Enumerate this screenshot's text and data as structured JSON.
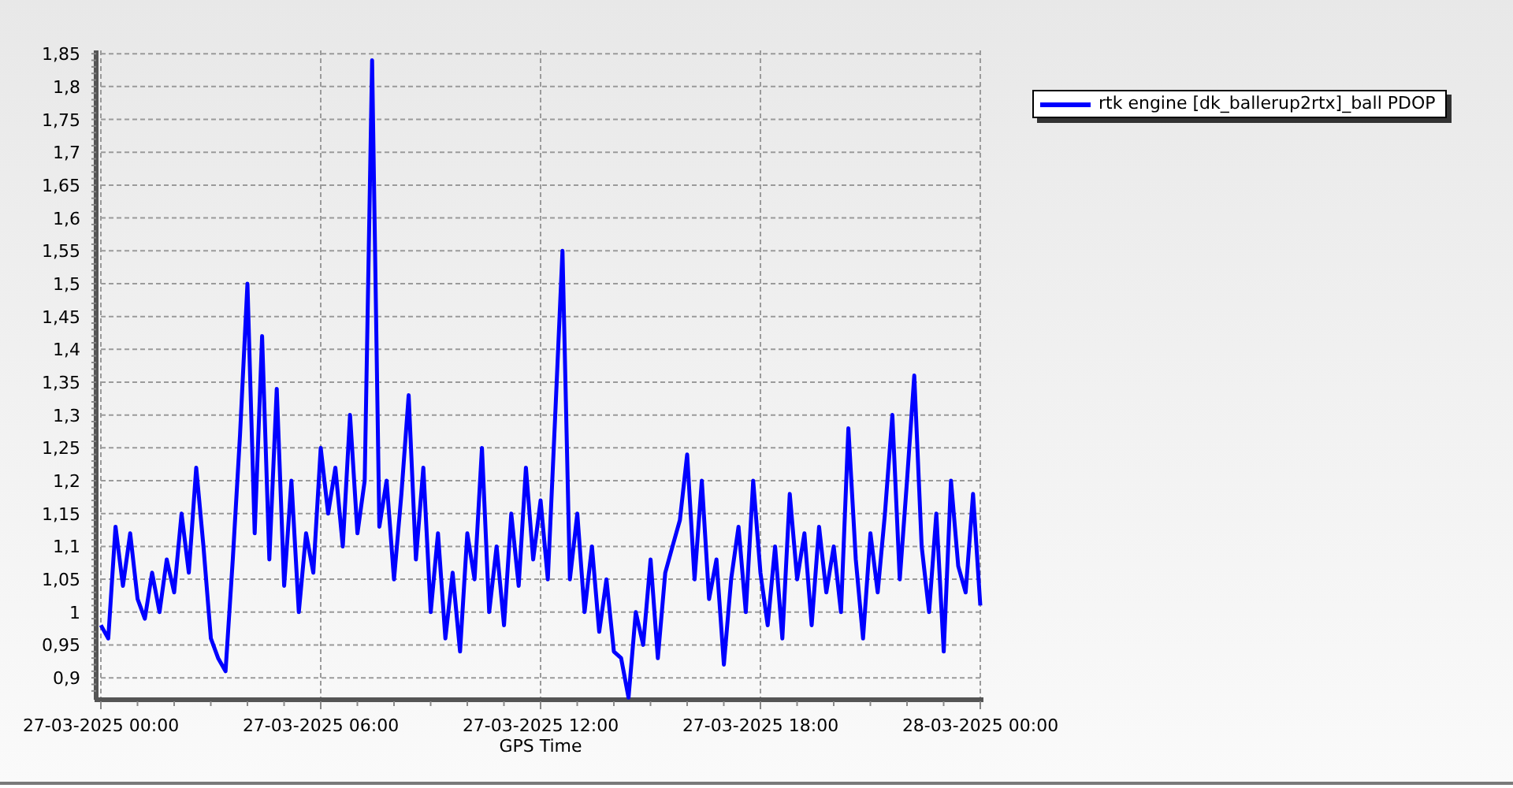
{
  "chart_data": {
    "type": "line",
    "grid": true,
    "xlabel": "GPS Time",
    "ylim": [
      0.869,
      1.855
    ],
    "yticks": [
      {
        "value": 0.9,
        "label": "0,9"
      },
      {
        "value": 0.95,
        "label": "0,95"
      },
      {
        "value": 1,
        "label": "1"
      },
      {
        "value": 1.05,
        "label": "1,05"
      },
      {
        "value": 1.1,
        "label": "1,1"
      },
      {
        "value": 1.15,
        "label": "1,15"
      },
      {
        "value": 1.2,
        "label": "1,2"
      },
      {
        "value": 1.25,
        "label": "1,25"
      },
      {
        "value": 1.3,
        "label": "1,3"
      },
      {
        "value": 1.35,
        "label": "1,35"
      },
      {
        "value": 1.4,
        "label": "1,4"
      },
      {
        "value": 1.45,
        "label": "1,45"
      },
      {
        "value": 1.5,
        "label": "1,5"
      },
      {
        "value": 1.55,
        "label": "1,55"
      },
      {
        "value": 1.6,
        "label": "1,6"
      },
      {
        "value": 1.65,
        "label": "1,65"
      },
      {
        "value": 1.7,
        "label": "1,7"
      },
      {
        "value": 1.75,
        "label": "1,75"
      },
      {
        "value": 1.8,
        "label": "1,8"
      },
      {
        "value": 1.85,
        "label": "1,85"
      }
    ],
    "categories": [
      "27-03-2025 00:00",
      null,
      null,
      null,
      null,
      null,
      null,
      null,
      null,
      null,
      null,
      null,
      null,
      null,
      null,
      null,
      null,
      null,
      null,
      null,
      null,
      null,
      null,
      null,
      null,
      null,
      null,
      null,
      null,
      null,
      "27-03-2025 06:00",
      null,
      null,
      null,
      null,
      null,
      null,
      null,
      null,
      null,
      null,
      null,
      null,
      null,
      null,
      null,
      null,
      null,
      null,
      null,
      null,
      null,
      null,
      null,
      null,
      null,
      null,
      null,
      null,
      null,
      "27-03-2025 12:00",
      null,
      null,
      null,
      null,
      null,
      null,
      null,
      null,
      null,
      null,
      null,
      null,
      null,
      null,
      null,
      null,
      null,
      null,
      null,
      null,
      null,
      null,
      null,
      null,
      null,
      null,
      null,
      null,
      null,
      "27-03-2025 18:00",
      null,
      null,
      null,
      null,
      null,
      null,
      null,
      null,
      null,
      null,
      null,
      null,
      null,
      null,
      null,
      null,
      null,
      null,
      null,
      null,
      null,
      null,
      null,
      null,
      null,
      null,
      null,
      null,
      null,
      "28-03-2025 00:00"
    ],
    "series": [
      {
        "name": "rtk engine [dk_ballerup2rtx]_ball PDOP",
        "color": "#0000ff",
        "values": [
          0.98,
          0.96,
          1.13,
          1.04,
          1.12,
          1.02,
          0.99,
          1.06,
          1.0,
          1.08,
          1.03,
          1.15,
          1.06,
          1.22,
          1.1,
          0.96,
          0.93,
          0.91,
          1.08,
          1.27,
          1.5,
          1.12,
          1.42,
          1.08,
          1.34,
          1.04,
          1.2,
          1.0,
          1.12,
          1.06,
          1.25,
          1.15,
          1.22,
          1.1,
          1.3,
          1.12,
          1.2,
          1.84,
          1.13,
          1.2,
          1.05,
          1.18,
          1.33,
          1.08,
          1.22,
          1.0,
          1.12,
          0.96,
          1.06,
          0.94,
          1.12,
          1.05,
          1.25,
          1.0,
          1.1,
          0.98,
          1.15,
          1.04,
          1.22,
          1.08,
          1.17,
          1.05,
          1.3,
          1.55,
          1.05,
          1.15,
          1.0,
          1.1,
          0.97,
          1.05,
          0.94,
          0.93,
          0.87,
          1.0,
          0.95,
          1.08,
          0.93,
          1.06,
          1.1,
          1.14,
          1.24,
          1.05,
          1.2,
          1.02,
          1.08,
          0.92,
          1.05,
          1.13,
          1.0,
          1.2,
          1.06,
          0.98,
          1.1,
          0.96,
          1.18,
          1.05,
          1.12,
          0.98,
          1.13,
          1.03,
          1.1,
          1.0,
          1.28,
          1.08,
          0.96,
          1.12,
          1.03,
          1.15,
          1.3,
          1.05,
          1.2,
          1.36,
          1.1,
          1.0,
          1.15,
          0.94,
          1.2,
          1.07,
          1.03,
          1.18,
          1.01
        ]
      }
    ]
  }
}
